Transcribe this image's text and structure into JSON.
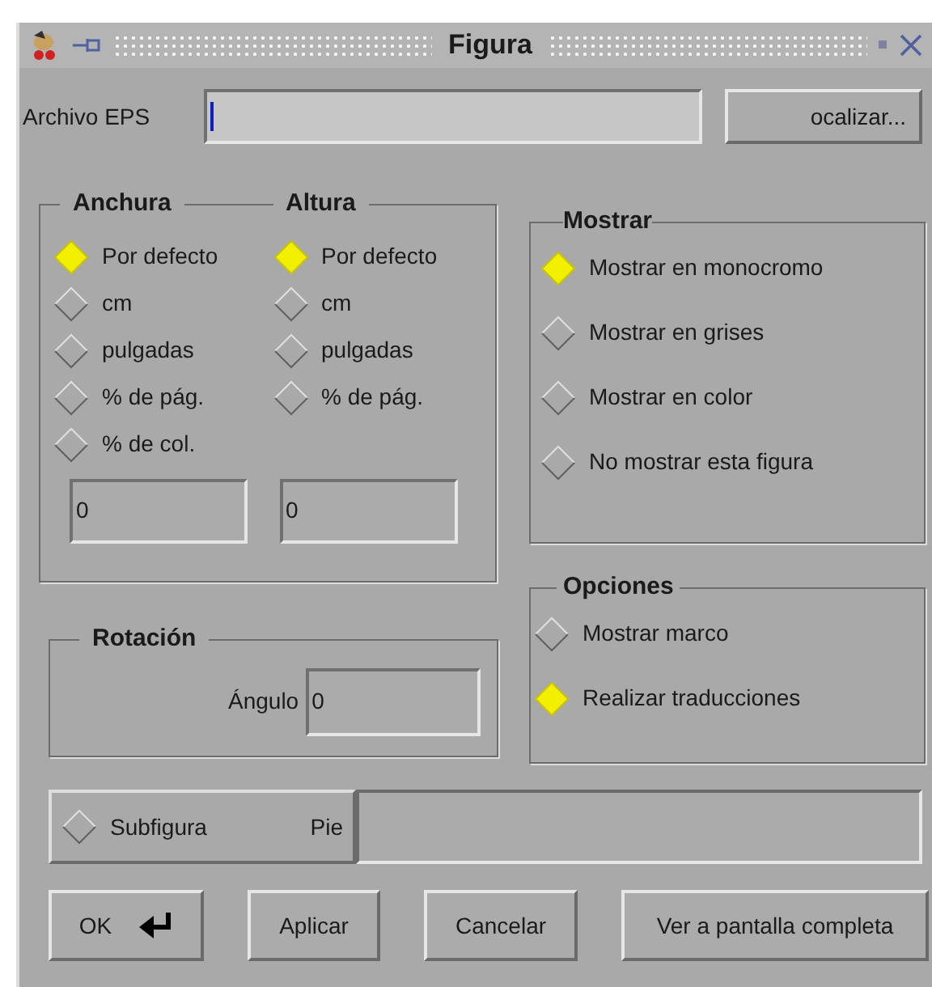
{
  "window": {
    "title": "Figura"
  },
  "file": {
    "label": "Archivo EPS",
    "browse_button": "ocalizar..."
  },
  "size": {
    "columns": [
      {
        "title": "Anchura",
        "value": "0",
        "options": [
          {
            "label": "Por defecto",
            "selected": true
          },
          {
            "label": "cm",
            "selected": false
          },
          {
            "label": "pulgadas",
            "selected": false
          },
          {
            "label": "% de pág.",
            "selected": false
          },
          {
            "label": "% de col.",
            "selected": false
          }
        ]
      },
      {
        "title": "Altura",
        "value": "0",
        "options": [
          {
            "label": "Por defecto",
            "selected": true
          },
          {
            "label": "cm",
            "selected": false
          },
          {
            "label": "pulgadas",
            "selected": false
          },
          {
            "label": "% de pág.",
            "selected": false
          }
        ]
      }
    ]
  },
  "display": {
    "title": "Mostrar",
    "options": [
      {
        "label": "Mostrar en monocromo",
        "selected": true
      },
      {
        "label": "Mostrar en grises",
        "selected": false
      },
      {
        "label": "Mostrar en color",
        "selected": false
      },
      {
        "label": "No mostrar esta figura",
        "selected": false
      }
    ]
  },
  "rotation": {
    "title": "Rotación",
    "label": "Ángulo",
    "value": "0"
  },
  "options": {
    "title": "Opciones",
    "items": [
      {
        "label": "Mostrar marco",
        "checked": false
      },
      {
        "label": "Realizar traducciones",
        "checked": true
      }
    ]
  },
  "subfigure": {
    "label": "Subfigura",
    "checked": false,
    "caption_label": "Pie"
  },
  "buttons": [
    {
      "label": "OK",
      "kind": "default"
    },
    {
      "label": "Aplicar",
      "kind": "normal"
    },
    {
      "label": "Cancelar",
      "kind": "normal"
    },
    {
      "label": "Ver a pantalla completa",
      "kind": "normal"
    }
  ]
}
